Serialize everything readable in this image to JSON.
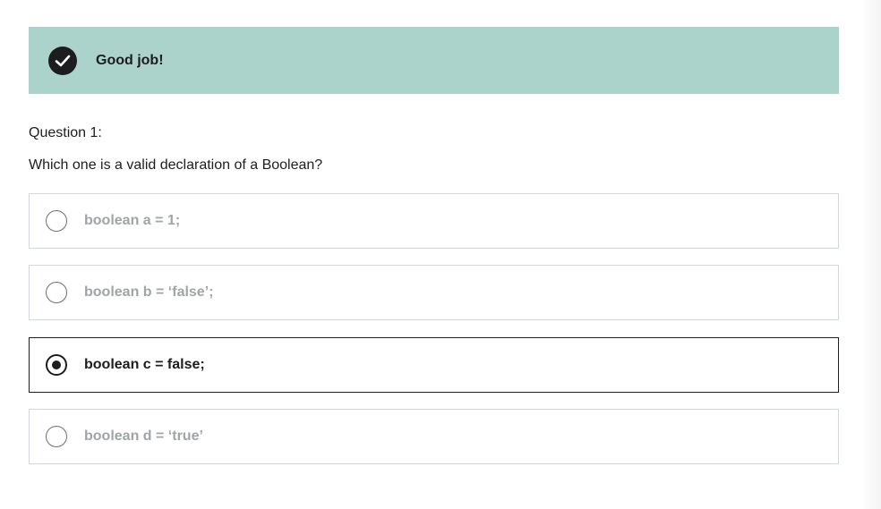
{
  "banner": {
    "icon": "check-circle-icon",
    "message": "Good job!",
    "background_color": "#acd2cc"
  },
  "question": {
    "number_label": "Question 1:",
    "prompt": "Which one is a valid declaration of a Boolean?"
  },
  "options": [
    {
      "label": "boolean a = 1;",
      "selected": false
    },
    {
      "label": "boolean b = ‘false’;",
      "selected": false
    },
    {
      "label": "boolean c = false;",
      "selected": true
    },
    {
      "label": "boolean d = ‘true’",
      "selected": false
    }
  ],
  "colors": {
    "text_primary": "#1c1d1f",
    "text_muted": "#a1a4a7",
    "border": "#d1d7dc"
  }
}
